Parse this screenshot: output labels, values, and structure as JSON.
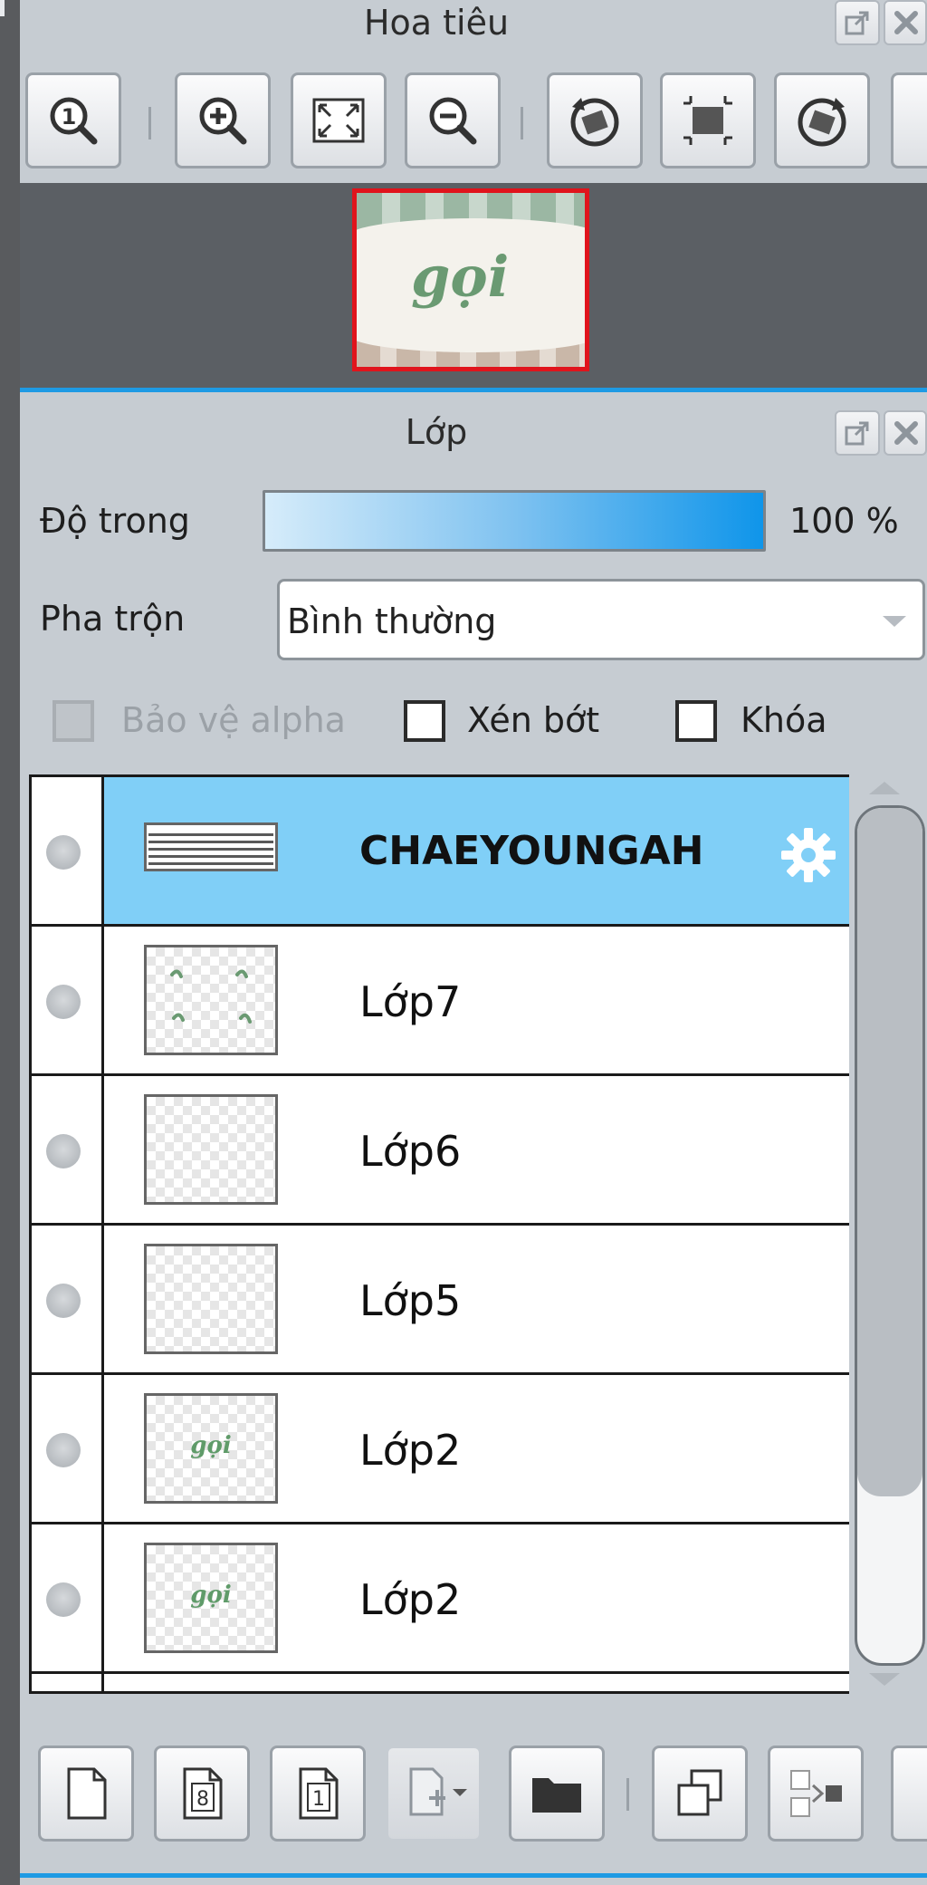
{
  "navigator": {
    "title": "Hoa tiêu",
    "tools": [
      {
        "icon": "zoom-actual-size-icon"
      },
      {
        "icon": "zoom-in-icon"
      },
      {
        "icon": "fit-to-window-icon"
      },
      {
        "icon": "zoom-out-icon"
      },
      {
        "icon": "rotate-left-icon"
      },
      {
        "icon": "reset-view-icon"
      },
      {
        "icon": "rotate-right-icon"
      }
    ],
    "preview_text": "gọi"
  },
  "layers": {
    "title": "Lớp",
    "opacity_label": "Độ trong",
    "opacity_value": "100 %",
    "opacity_fraction": 1.0,
    "blend_label": "Pha trộn",
    "blend_value": "Bình thường",
    "protect_alpha_label": "Bảo vệ alpha",
    "clipping_label": "Xén bớt",
    "lock_label": "Khóa",
    "items": [
      {
        "name": "CHAEYOUNGAH",
        "selected": true,
        "thumb": "text"
      },
      {
        "name": "Lớp7",
        "selected": false,
        "thumb": "sparkles"
      },
      {
        "name": "Lớp6",
        "selected": false,
        "thumb": "empty"
      },
      {
        "name": "Lớp5",
        "selected": false,
        "thumb": "empty"
      },
      {
        "name": "Lớp2",
        "selected": false,
        "thumb": "script",
        "thumb_text": "gọi"
      },
      {
        "name": "Lớp2",
        "selected": false,
        "thumb": "script",
        "thumb_text": "gọi"
      },
      {
        "name": "",
        "selected": false,
        "thumb": "empty"
      }
    ],
    "bottom_tools": [
      {
        "icon": "new-layer-icon"
      },
      {
        "icon": "new-8bit-layer-icon",
        "text": "8"
      },
      {
        "icon": "new-1bit-layer-icon",
        "text": "1"
      },
      {
        "icon": "add-layer-dropdown-icon"
      },
      {
        "icon": "new-folder-icon"
      },
      {
        "icon": "duplicate-layer-icon"
      },
      {
        "icon": "transfer-layer-icon"
      }
    ]
  },
  "colors": {
    "accent": "#1e9ae4",
    "selected_row": "#80cff7",
    "panel_bg": "#c6ccd2"
  }
}
